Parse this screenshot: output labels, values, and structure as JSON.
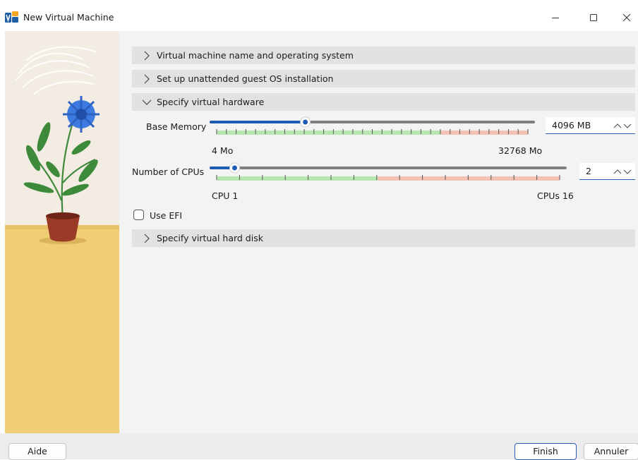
{
  "window": {
    "title": "New Virtual Machine",
    "controls": [
      "minimize-icon",
      "maximize-icon",
      "close-icon"
    ]
  },
  "sections": {
    "name_os": {
      "label": "Virtual machine name and operating system",
      "expanded": false
    },
    "unattended": {
      "label": "Set up unattended guest OS installation",
      "expanded": false
    },
    "hardware": {
      "label": "Specify virtual hardware",
      "expanded": true
    },
    "disk": {
      "label": "Specify virtual hard disk",
      "expanded": false
    }
  },
  "hardware": {
    "memory": {
      "label": "Base Memory",
      "value": 4096,
      "value_text": "4096 MB",
      "min_label": "4 Mo",
      "max_label": "32768 Mo",
      "min": 4,
      "max": 32768,
      "recommended_fraction": 0.72
    },
    "cpus": {
      "label": "Number of CPUs",
      "value": 2,
      "value_text": "2",
      "min_label": "CPU 1",
      "max_label": "CPUs 16",
      "min": 1,
      "max": 16,
      "recommended_fraction": 0.47
    },
    "efi": {
      "label": "Use EFI",
      "checked": false
    }
  },
  "footer": {
    "help_label": "Aide",
    "finish_label": "Finish",
    "cancel_label": "Annuler"
  },
  "colors": {
    "accent": "#1e5cb3",
    "section_bg": "#e2e2e2",
    "range_ok": "#b8e6b0",
    "range_warn": "#f2c3b4",
    "track": "#808080"
  }
}
